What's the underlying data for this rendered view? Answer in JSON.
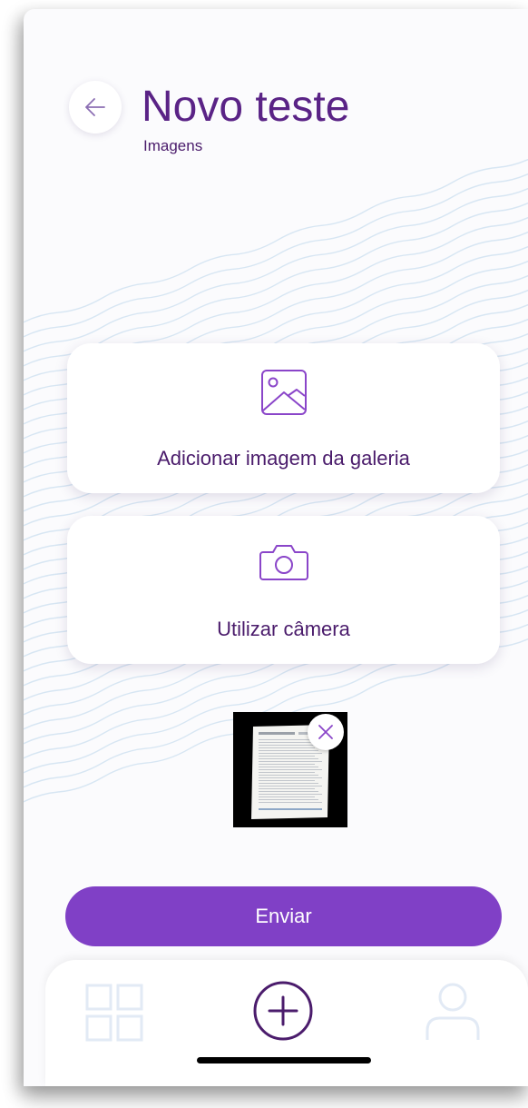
{
  "header": {
    "title": "Novo teste",
    "subtitle": "Imagens"
  },
  "icons": {
    "back": "arrow-left-icon",
    "gallery": "image-icon",
    "camera": "camera-icon",
    "remove": "close-icon",
    "nav_home": "grid-icon",
    "nav_add": "plus-circle-icon",
    "nav_profile": "user-icon"
  },
  "options": [
    {
      "label": "Adicionar imagem da galeria",
      "icon": "image-icon"
    },
    {
      "label": "Utilizar câmera",
      "icon": "camera-icon"
    }
  ],
  "attachments": [
    {
      "type": "document-photo"
    }
  ],
  "actions": {
    "submit_label": "Enviar"
  },
  "colors": {
    "accent": "#8040c6",
    "title": "#5a2386",
    "text": "#4a1b6b",
    "wave": "#d7e6f3",
    "nav_icon_inactive": "#e2eaf5"
  }
}
